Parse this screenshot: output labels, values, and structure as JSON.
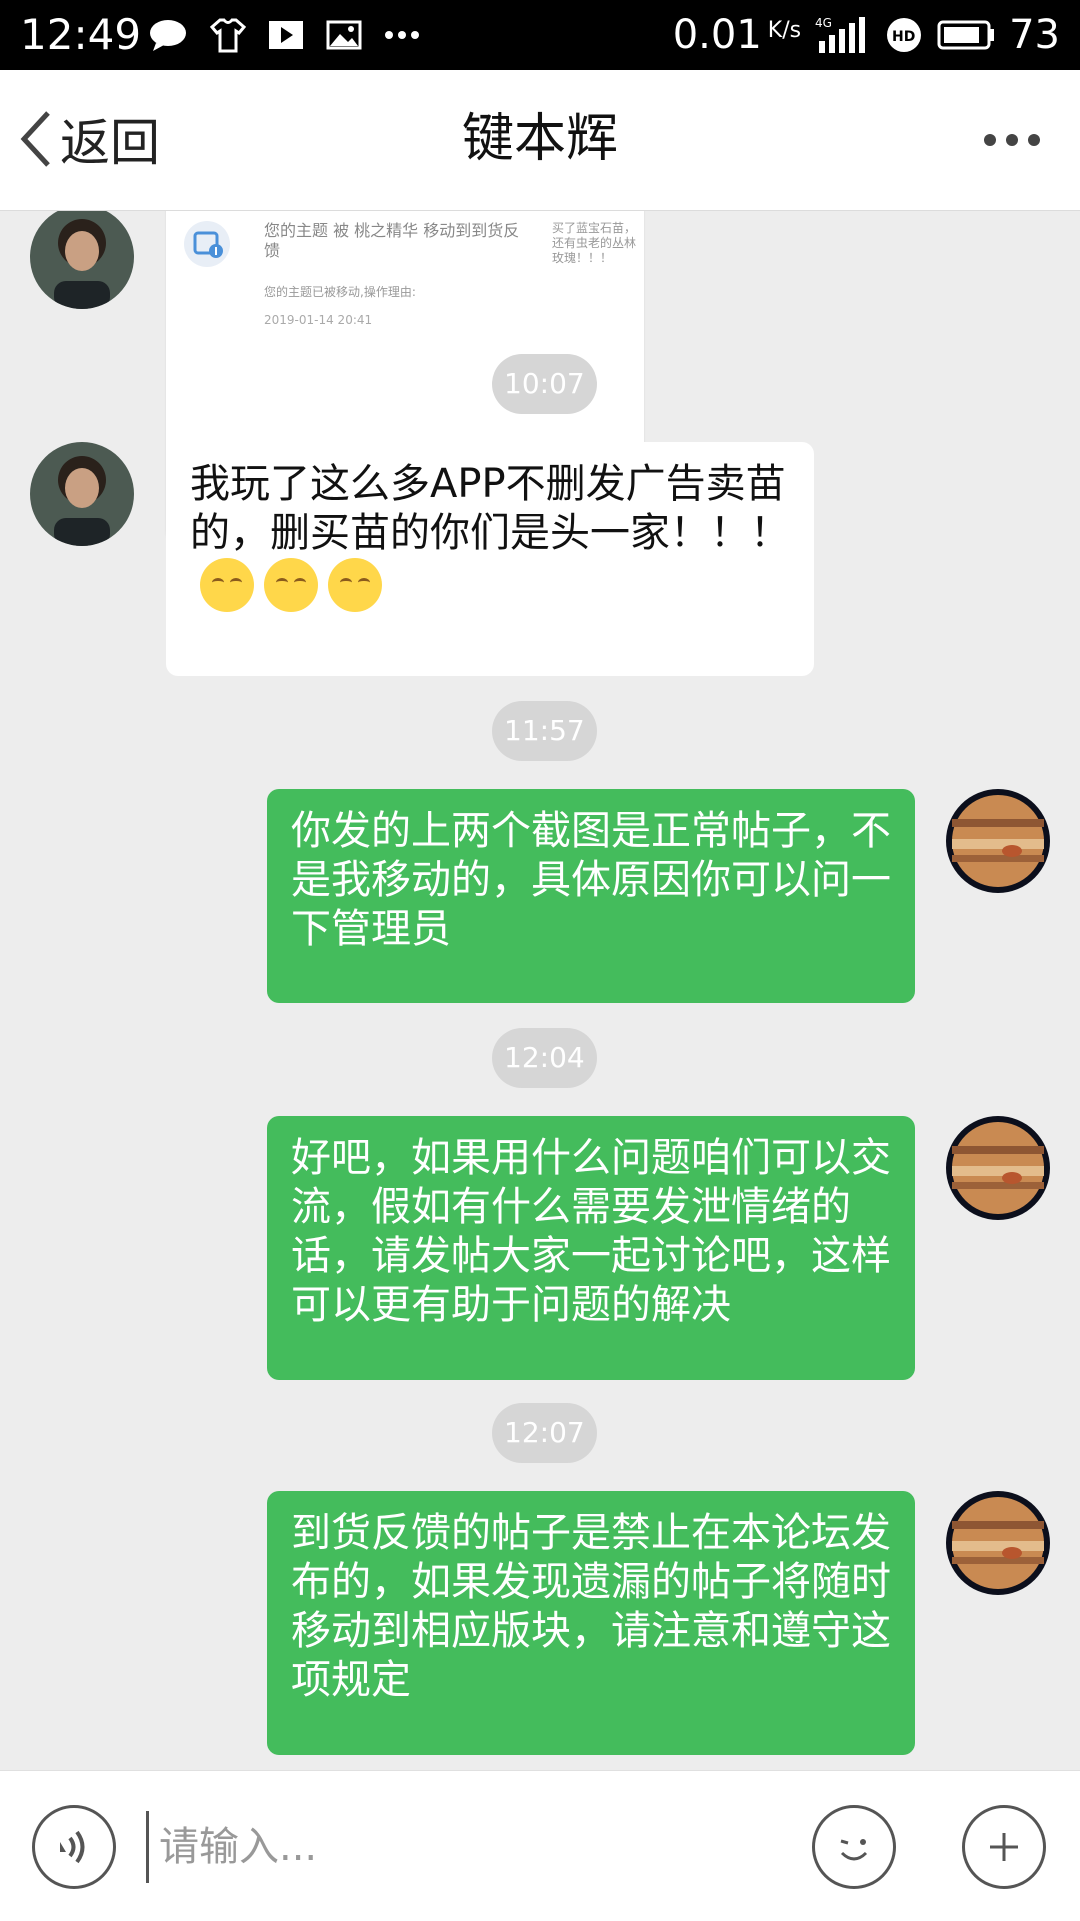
{
  "status_bar": {
    "time": "12:49",
    "icons": [
      "message-icon",
      "shirt-icon",
      "play-icon",
      "image-icon",
      "more-icon"
    ],
    "speed": "0.01",
    "speed_unit": "K/s",
    "network": "4G",
    "battery": "73"
  },
  "header": {
    "back_label": "返回",
    "title": "键本辉"
  },
  "messages": {
    "card": {
      "title": "您的主题 被 桃之精华 移动到到货反馈",
      "reason": "您的主题已被移动,操作理由:",
      "date": "2019-01-14 20:41",
      "snippet": "买了蓝宝石苗，还有虫老的丛林玫瑰！！！"
    },
    "time1": "10:07",
    "msg1": "我玩了这么多APP不删发广告卖苗的，删买苗的你们是头一家！！！",
    "time2": "11:57",
    "msg2": "你发的上两个截图是正常帖子，不是我移动的，具体原因你可以问一下管理员",
    "time3": "12:04",
    "msg3": "好吧，如果用什么问题咱们可以交流，假如有什么需要发泄情绪的话，请发帖大家一起讨论吧，这样可以更有助于问题的解决",
    "time4": "12:07",
    "msg4": "到货反馈的帖子是禁止在本论坛发布的，如果发现遗漏的帖子将随时移动到相应版块，请注意和遵守这项规定"
  },
  "input": {
    "placeholder": "请输入..."
  }
}
